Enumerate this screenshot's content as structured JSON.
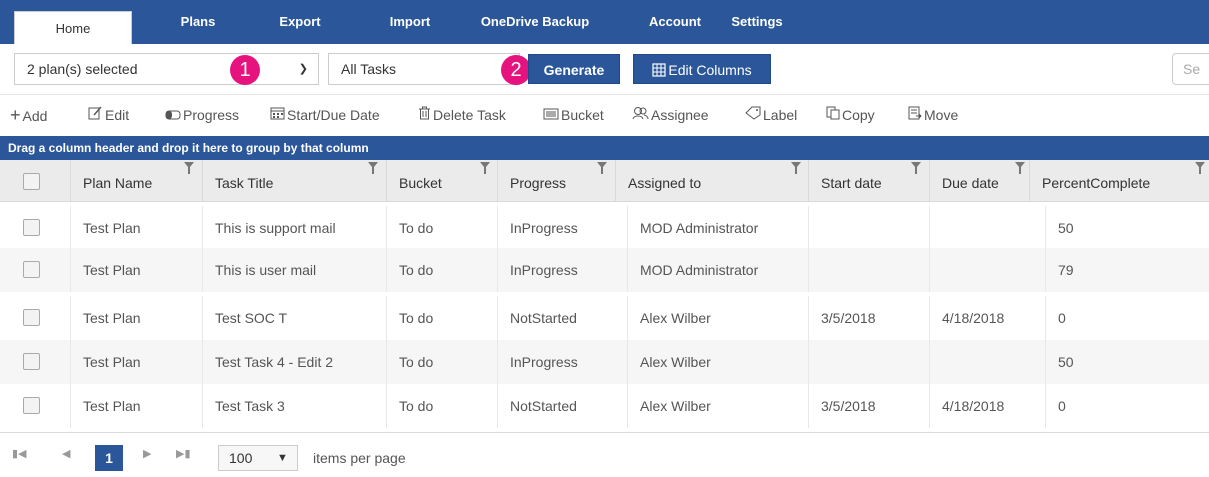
{
  "nav": {
    "tabs": [
      "Home",
      "Plans",
      "Export",
      "Import",
      "OneDrive Backup",
      "Account",
      "Settings"
    ],
    "active": "Home"
  },
  "controls": {
    "plan_select": "2 plan(s) selected",
    "task_filter": "All Tasks",
    "generate_label": "Generate",
    "edit_columns_label": "Edit Columns",
    "search_placeholder": "Se",
    "badge_1": "1",
    "badge_2": "2"
  },
  "toolbar": {
    "add": "Add",
    "edit": "Edit",
    "progress": "Progress",
    "start_due": "Start/Due Date",
    "delete": "Delete Task",
    "bucket": "Bucket",
    "assignee": "Assignee",
    "label": "Label",
    "copy": "Copy",
    "move": "Move"
  },
  "group_hint": "Drag a column header and drop it here to group by that column",
  "columns": [
    "Plan Name",
    "Task Title",
    "Bucket",
    "Progress",
    "Assigned to",
    "Start date",
    "Due date",
    "PercentComplete"
  ],
  "rows": [
    [
      "Test Plan",
      "This is support mail",
      "To do",
      "InProgress",
      "MOD Administrator",
      "",
      "",
      "50"
    ],
    [
      "Test Plan",
      "This is user mail",
      "To do",
      "InProgress",
      "MOD Administrator",
      "",
      "",
      "79"
    ],
    [
      "Test Plan",
      "Test SOC T",
      "To do",
      "NotStarted",
      "Alex Wilber",
      "3/5/2018",
      "4/18/2018",
      "0"
    ],
    [
      "Test Plan",
      "Test Task 4 - Edit 2",
      "To do",
      "InProgress",
      "Alex Wilber",
      "",
      "",
      "50"
    ],
    [
      "Test Plan",
      "Test Task 3",
      "To do",
      "NotStarted",
      "Alex Wilber",
      "3/5/2018",
      "4/18/2018",
      "0"
    ]
  ],
  "pager": {
    "current_page": "1",
    "page_size": "100",
    "label": "items per page"
  },
  "colors": {
    "brand": "#2b579a",
    "badge": "#e6137f"
  }
}
